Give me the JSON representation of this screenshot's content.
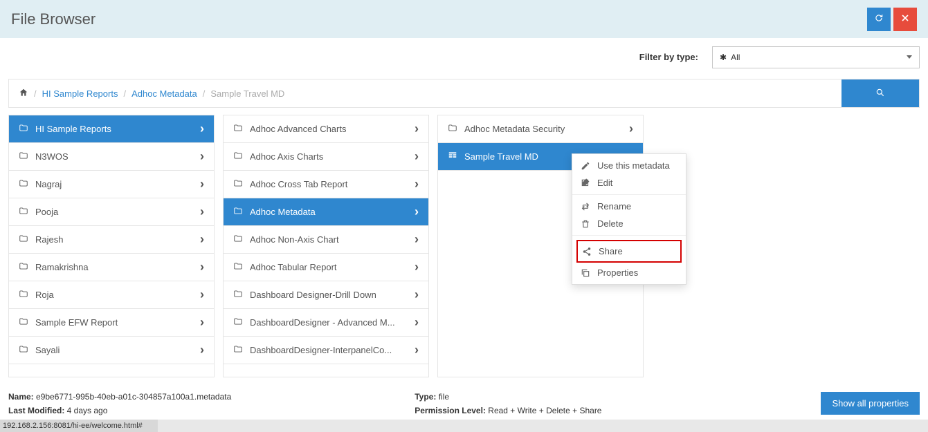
{
  "header": {
    "title": "File Browser"
  },
  "filter": {
    "label": "Filter by type:",
    "selected": "All"
  },
  "breadcrumbs": {
    "items": [
      "HI Sample Reports",
      "Adhoc Metadata"
    ],
    "current": "Sample Travel MD"
  },
  "columns": [
    {
      "selected_index": 0,
      "items": [
        {
          "label": "HI Sample Reports",
          "type": "folder-open",
          "nav": true
        },
        {
          "label": "N3WOS",
          "type": "folder",
          "nav": true
        },
        {
          "label": "Nagraj",
          "type": "folder",
          "nav": true
        },
        {
          "label": "Pooja",
          "type": "folder",
          "nav": true
        },
        {
          "label": "Rajesh",
          "type": "folder",
          "nav": true
        },
        {
          "label": "Ramakrishna",
          "type": "folder",
          "nav": true
        },
        {
          "label": "Roja",
          "type": "folder",
          "nav": true
        },
        {
          "label": "Sample EFW Report",
          "type": "folder",
          "nav": true
        },
        {
          "label": "Sayali",
          "type": "folder",
          "nav": true
        }
      ]
    },
    {
      "selected_index": 3,
      "items": [
        {
          "label": "Adhoc Advanced Charts",
          "type": "folder",
          "nav": true
        },
        {
          "label": "Adhoc Axis Charts",
          "type": "folder",
          "nav": true
        },
        {
          "label": "Adhoc Cross Tab Report",
          "type": "folder",
          "nav": true
        },
        {
          "label": "Adhoc Metadata",
          "type": "folder-open",
          "nav": true
        },
        {
          "label": "Adhoc Non-Axis Chart",
          "type": "folder",
          "nav": true
        },
        {
          "label": "Adhoc Tabular Report",
          "type": "folder",
          "nav": true
        },
        {
          "label": "Dashboard Designer-Drill Down",
          "type": "folder",
          "nav": true
        },
        {
          "label": "DashboardDesigner - Advanced M...",
          "type": "folder",
          "nav": true
        },
        {
          "label": "DashboardDesigner-InterpanelCo...",
          "type": "folder",
          "nav": true
        }
      ]
    },
    {
      "selected_index": 1,
      "items": [
        {
          "label": "Adhoc Metadata Security",
          "type": "folder",
          "nav": true
        },
        {
          "label": "Sample Travel MD",
          "type": "grid",
          "nav": false
        }
      ]
    }
  ],
  "context_menu": {
    "groups": [
      [
        {
          "icon": "pencil",
          "label": "Use this metadata"
        },
        {
          "icon": "edit",
          "label": "Edit"
        }
      ],
      [
        {
          "icon": "retweet",
          "label": "Rename"
        },
        {
          "icon": "trash",
          "label": "Delete"
        }
      ],
      [
        {
          "icon": "share",
          "label": "Share",
          "highlight": true
        },
        {
          "icon": "copy",
          "label": "Properties"
        }
      ]
    ]
  },
  "details": {
    "name_label": "Name:",
    "name_value": "e9be6771-995b-40eb-a01c-304857a100a1.metadata",
    "lastmod_label": "Last Modified:",
    "lastmod_value": "4 days ago",
    "type_label": "Type:",
    "type_value": "file",
    "perm_label": "Permission Level:",
    "perm_value": "Read + Write + Delete + Share",
    "show_all": "Show all properties"
  },
  "statusbar": "192.168.2.156:8081/hi-ee/welcome.html#"
}
